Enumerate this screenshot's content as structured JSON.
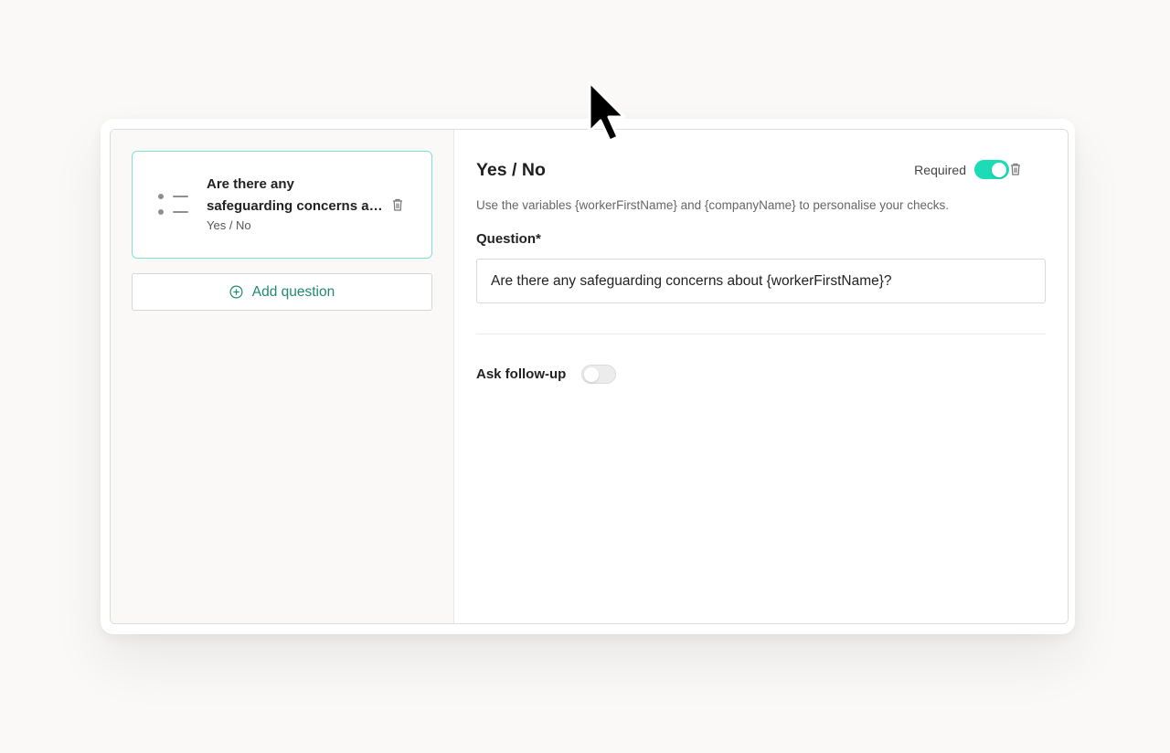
{
  "question_list": {
    "items": [
      {
        "title_line1": "Are there any",
        "title_line2": "safeguarding concerns about {workerFirstName}?",
        "type": "Yes / No",
        "selected": true,
        "icon": "list-icon"
      }
    ],
    "add_button_label": "Add question",
    "add_button_icon": "plus-circle-icon"
  },
  "editor": {
    "title": "Yes / No",
    "required_label": "Required",
    "required_on": true,
    "hint": "Use the variables {workerFirstName} and {companyName} to personalise your checks.",
    "question_label": "Question*",
    "question_value": "Are there any safeguarding concerns about {workerFirstName}?",
    "follow_up_label": "Ask follow-up",
    "follow_up_on": false
  },
  "colors": {
    "accent": "#1bdcb4",
    "selected_border": "#7ee3cf",
    "add_text": "#1f8a6e"
  }
}
